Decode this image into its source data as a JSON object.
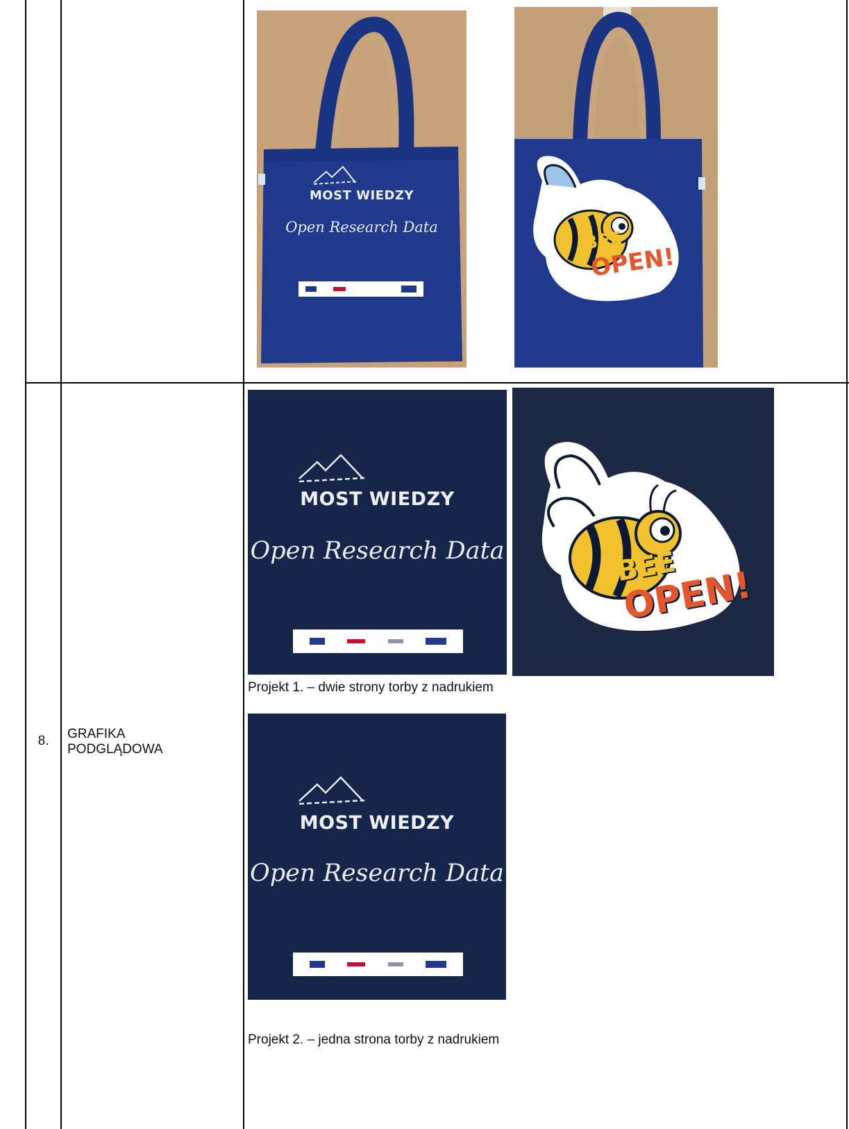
{
  "row8": {
    "number": "8.",
    "label": "GRAFIKA PODGLĄDOWA",
    "caption_project1": "Projekt 1. – dwie strony torby z nadrukiem",
    "caption_project2": "Projekt 2. – jedna strona torby z nadrukiem"
  },
  "graphics": {
    "brand": "MOST WIEDZY",
    "tagline": "Open Research Data",
    "bee_word1": "BEE",
    "bee_word2": "OPEN!"
  },
  "colors": {
    "navy": "#16254a",
    "bag_blue": "#1f3a8c",
    "bee_yellow": "#f2c12e",
    "bee_orange": "#e2572b",
    "wood": "#c9a57d"
  }
}
